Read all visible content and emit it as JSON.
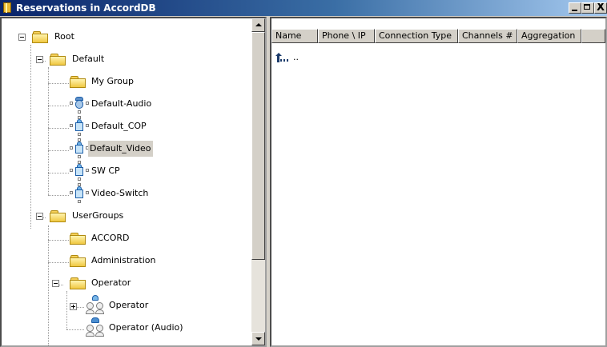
{
  "window": {
    "title": "Reservations in AccordDB",
    "buttons": {
      "minimize": "_",
      "maximize": "□",
      "close": "X"
    }
  },
  "tree": {
    "root": {
      "label": "Root",
      "expanded": true
    },
    "default": {
      "label": "Default",
      "expanded": true,
      "items": [
        {
          "label": "My Group",
          "icon": "folder-icon"
        },
        {
          "label": "Default-Audio",
          "icon": "audio-device-icon"
        },
        {
          "label": "Default_COP",
          "icon": "video-device-icon"
        },
        {
          "label": "Default_Video",
          "icon": "video-device-icon",
          "selected": true
        },
        {
          "label": "SW CP",
          "icon": "video-device-icon"
        },
        {
          "label": "Video-Switch",
          "icon": "video-device-icon"
        }
      ]
    },
    "usergroups": {
      "label": "UserGroups",
      "expanded": true,
      "items": [
        {
          "label": "ACCORD",
          "icon": "folder-icon"
        },
        {
          "label": "Administration",
          "icon": "folder-icon"
        }
      ],
      "operator": {
        "label": "Operator",
        "expanded": true,
        "items": [
          {
            "label": "Operator",
            "icon": "operator-group-icon",
            "collapsed": true
          },
          {
            "label": "Operator (Audio)",
            "icon": "operator-group-audio-icon"
          }
        ]
      }
    }
  },
  "list": {
    "columns": [
      "Name",
      "Phone \\ IP",
      "Connection Type",
      "Channels #",
      "Aggregation"
    ],
    "up_label": ".."
  }
}
